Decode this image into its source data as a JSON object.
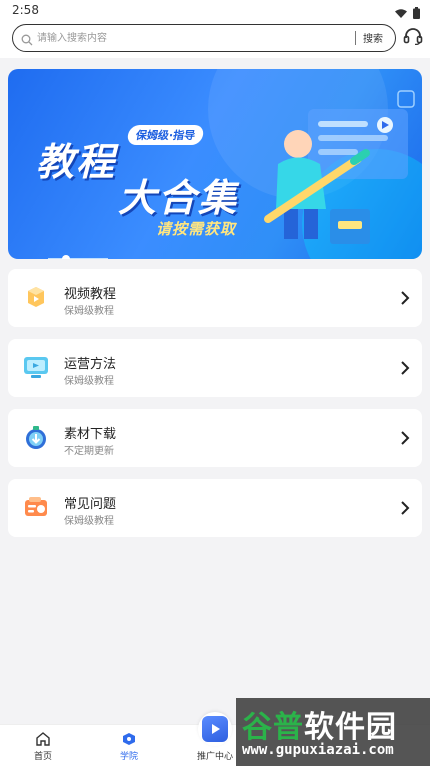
{
  "status_bar": {
    "time": "2:58",
    "icons": [
      "wifi-icon",
      "battery-icon"
    ]
  },
  "search": {
    "placeholder": "请输入搜索内容",
    "button_label": "搜索",
    "support_icon": "headset-icon"
  },
  "banner": {
    "tag": "保姆级·指导",
    "title_line1": "教程",
    "title_line2": "大合集",
    "subtitle": "请按需获取"
  },
  "cards": [
    {
      "title": "视频教程",
      "subtitle": "保姆级教程",
      "icon": "video-icon"
    },
    {
      "title": "运营方法",
      "subtitle": "保姆级教程",
      "icon": "monitor-icon"
    },
    {
      "title": "素材下载",
      "subtitle": "不定期更新",
      "icon": "download-icon"
    },
    {
      "title": "常见问题",
      "subtitle": "保姆级教程",
      "icon": "question-icon"
    }
  ],
  "bottom_nav": {
    "items": [
      {
        "label": "首页",
        "icon": "home-icon",
        "active": false
      },
      {
        "label": "学院",
        "icon": "academy-icon",
        "active": true
      },
      {
        "label": "推广中心",
        "icon": "promotion-icon",
        "active": false
      }
    ]
  },
  "watermark": {
    "title_green": "谷普",
    "title_white": "软件园",
    "url": "www.gupuxiazai.com"
  },
  "colors": {
    "accent": "#2f6bec",
    "banner": "#2a7cf5",
    "watermark_green": "#2bb34a"
  }
}
